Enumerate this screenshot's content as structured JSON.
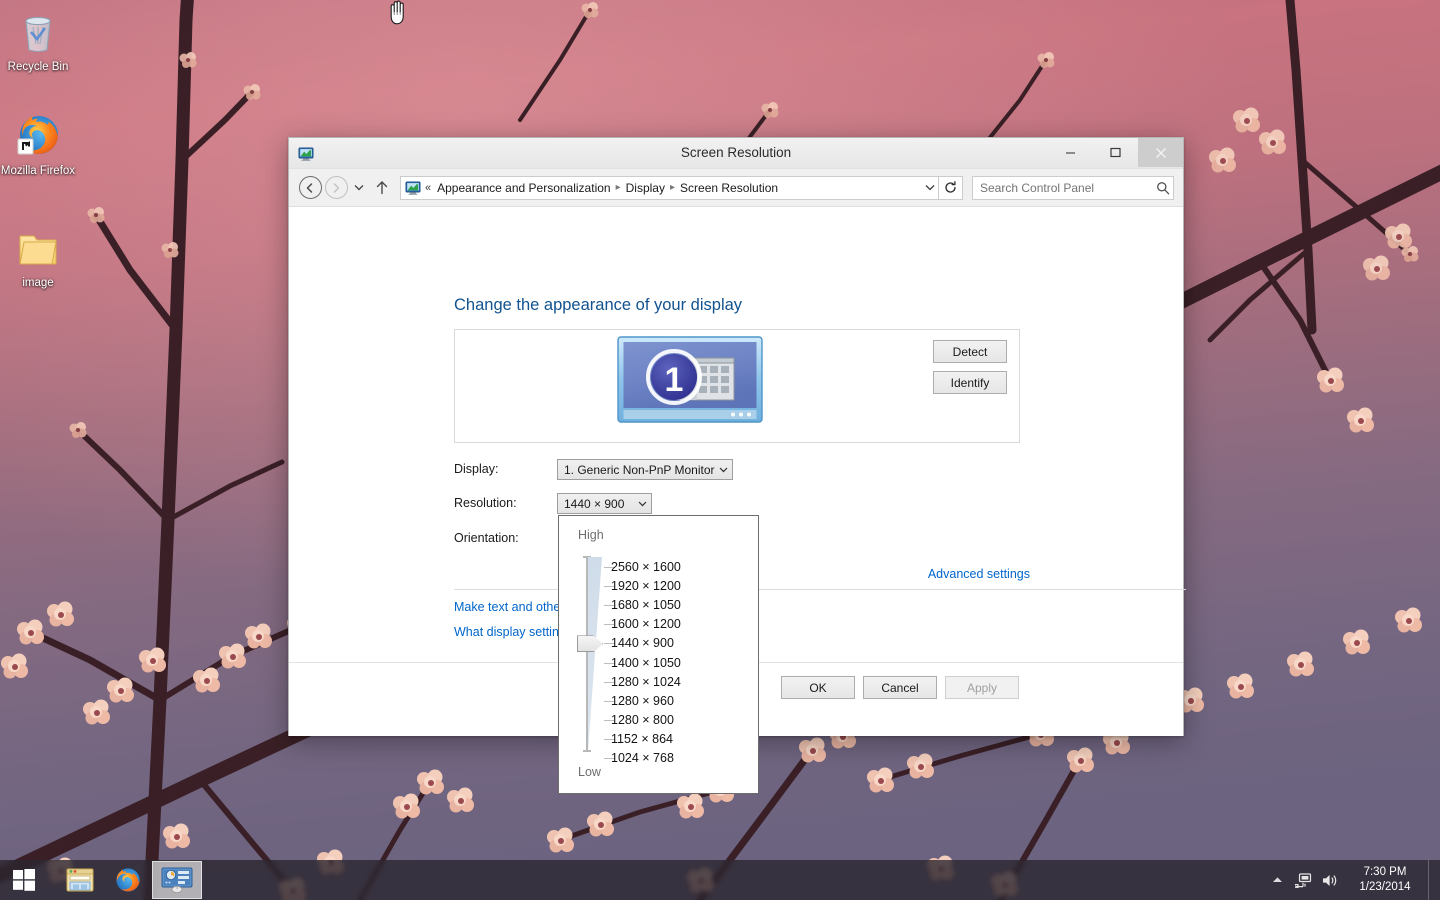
{
  "desktop": {
    "icons": [
      {
        "name": "recycle-bin",
        "label": "Recycle Bin"
      },
      {
        "name": "mozilla-firefox",
        "label": "Mozilla Firefox"
      },
      {
        "name": "image-folder",
        "label": "image"
      }
    ],
    "cursor": "hand-cursor"
  },
  "window": {
    "title": "Screen Resolution",
    "icon": "display-settings-icon",
    "caption": {
      "minimize": "minimize-button",
      "maximize": "maximize-button",
      "close": "close-button"
    }
  },
  "navbar": {
    "back": "back-button",
    "forward": "forward-button",
    "recent": "recent-pages-button",
    "up": "up-one-level-button",
    "refresh": "refresh-button",
    "address_icon": "control-panel-icon",
    "chevron": "«",
    "breadcrumbs": [
      "Appearance and Personalization",
      "Display",
      "Screen Resolution"
    ],
    "search": {
      "placeholder": "Search Control Panel",
      "value": ""
    }
  },
  "main": {
    "heading": "Change the appearance of your display",
    "monitor_preview": {
      "number": "1"
    },
    "buttons": {
      "detect": "Detect",
      "identify": "Identify"
    },
    "fields": {
      "display_label": "Display:",
      "display_value": "1. Generic Non-PnP Monitor",
      "resolution_label": "Resolution:",
      "resolution_value": "1440 × 900",
      "orientation_label": "Orientation:"
    },
    "advanced_settings": "Advanced settings",
    "links": [
      "Make text and other",
      "What display setting"
    ]
  },
  "resolution_flyout": {
    "high_label": "High",
    "low_label": "Low",
    "selected_index": 4,
    "options": [
      "2560 × 1600",
      "1920 × 1200",
      "1680 × 1050",
      "1600 × 1200",
      "1440 × 900",
      "1400 × 1050",
      "1280 × 1024",
      "1280 × 960",
      "1280 × 800",
      "1152 × 864",
      "1024 × 768"
    ]
  },
  "footer": {
    "ok": "OK",
    "cancel": "Cancel",
    "apply": "Apply",
    "apply_disabled": true
  },
  "taskbar": {
    "start": "start-button",
    "items": [
      {
        "name": "file-explorer",
        "active": false
      },
      {
        "name": "mozilla-firefox",
        "active": false
      },
      {
        "name": "screen-resolution-window",
        "active": true
      }
    ],
    "tray": [
      {
        "name": "show-hidden-icons"
      },
      {
        "name": "network-icon"
      },
      {
        "name": "volume-icon"
      }
    ],
    "clock": {
      "time": "7:30 PM",
      "date": "1/23/2014"
    }
  },
  "colors": {
    "accent_link": "#0066cc",
    "heading": "#12538f",
    "window_bg": "#ffffff",
    "titlebar": "#ebebeb",
    "close_hover": "#e81123",
    "slider_fill": "#cfdce9"
  }
}
